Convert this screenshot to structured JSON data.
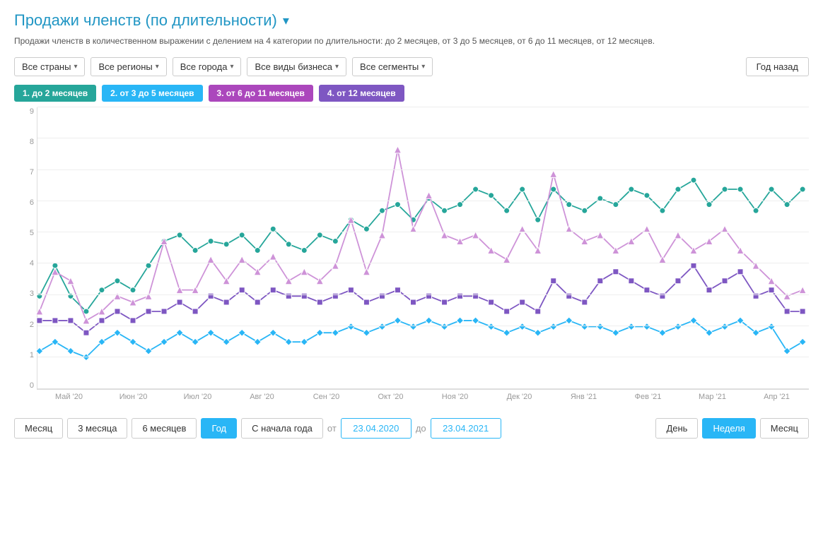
{
  "title": "Продажи членств (по длительности)",
  "subtitle": "Продажи членств в количественном выражении с делением на 4 категории по длительности: до 2 месяцев, от 3 до 5 месяцев, от 6 до 11 месяцев, от 12 месяцев.",
  "filters": [
    {
      "label": "Все страны",
      "id": "countries"
    },
    {
      "label": "Все регионы",
      "id": "regions"
    },
    {
      "label": "Все города",
      "id": "cities"
    },
    {
      "label": "Все виды бизнеса",
      "id": "business"
    },
    {
      "label": "Все сегменты",
      "id": "segments"
    }
  ],
  "year_btn_label": "Год назад",
  "legend": [
    {
      "label": "1. до 2 месяцев",
      "class": "chip-green"
    },
    {
      "label": "2. от 3 до 5 месяцев",
      "class": "chip-blue"
    },
    {
      "label": "3. от 6 до 11 месяцев",
      "class": "chip-pink"
    },
    {
      "label": "4. от 12 месяцев",
      "class": "chip-purple"
    }
  ],
  "y_labels": [
    "0",
    "1",
    "2",
    "3",
    "4",
    "5",
    "6",
    "7",
    "8",
    "9"
  ],
  "x_labels": [
    "Май '20",
    "Июн '20",
    "Июл '20",
    "Авг '20",
    "Сен '20",
    "Окт '20",
    "Ноя '20",
    "Дек '20",
    "Янв '21",
    "Фев '21",
    "Мар '21",
    "Апр '21"
  ],
  "bottom_controls": {
    "period_buttons": [
      "Месяц",
      "3 месяца",
      "6 месяцев",
      "Год",
      "С начала года"
    ],
    "active_period": "Год",
    "from_label": "от",
    "to_label": "до",
    "from_date": "23.04.2020",
    "to_date": "23.04.2021",
    "view_buttons": [
      "День",
      "Неделя",
      "Месяц"
    ],
    "active_view": "Неделя"
  },
  "chart": {
    "green": [
      3.0,
      4.0,
      3.0,
      2.5,
      3.2,
      3.5,
      3.2,
      4.0,
      4.8,
      5.0,
      4.5,
      4.8,
      4.7,
      5.0,
      4.5,
      5.2,
      4.7,
      4.5,
      5.0,
      4.8,
      5.5,
      5.2,
      5.8,
      6.0,
      5.5,
      6.2,
      5.8,
      6.0,
      6.5,
      6.3,
      5.8,
      6.5,
      5.5,
      6.5,
      6.0,
      5.8,
      6.2,
      6.0,
      6.5,
      6.3,
      5.8,
      6.5,
      6.8,
      6.0,
      6.5,
      6.5,
      5.8,
      6.5,
      6.0,
      6.5
    ],
    "blue": [
      1.2,
      1.5,
      1.2,
      1.0,
      1.5,
      1.8,
      1.5,
      1.2,
      1.5,
      1.8,
      1.5,
      1.8,
      1.5,
      1.8,
      1.5,
      1.8,
      1.5,
      1.5,
      1.8,
      1.8,
      2.0,
      1.8,
      2.0,
      2.2,
      2.0,
      2.2,
      2.0,
      2.2,
      2.2,
      2.0,
      1.8,
      2.0,
      1.8,
      2.0,
      2.2,
      2.0,
      2.0,
      1.8,
      2.0,
      2.0,
      1.8,
      2.0,
      2.2,
      1.8,
      2.0,
      2.2,
      1.8,
      2.0,
      1.2,
      1.5
    ],
    "pink": [
      2.5,
      3.8,
      3.5,
      2.2,
      2.5,
      3.0,
      2.8,
      3.0,
      4.8,
      3.2,
      3.2,
      4.2,
      3.5,
      4.2,
      3.8,
      4.3,
      3.5,
      3.8,
      3.5,
      4.0,
      5.5,
      3.8,
      5.0,
      7.8,
      5.2,
      6.3,
      5.0,
      4.8,
      5.0,
      4.5,
      4.2,
      5.2,
      4.5,
      7.0,
      5.2,
      4.8,
      5.0,
      4.5,
      4.8,
      5.2,
      4.2,
      5.0,
      4.5,
      4.8,
      5.2,
      4.5,
      4.0,
      3.5,
      3.0,
      3.2
    ],
    "purple": [
      2.2,
      2.2,
      2.2,
      1.8,
      2.2,
      2.5,
      2.2,
      2.5,
      2.5,
      2.8,
      2.5,
      3.0,
      2.8,
      3.2,
      2.8,
      3.2,
      3.0,
      3.0,
      2.8,
      3.0,
      3.2,
      2.8,
      3.0,
      3.2,
      2.8,
      3.0,
      2.8,
      3.0,
      3.0,
      2.8,
      2.5,
      2.8,
      2.5,
      3.5,
      3.0,
      2.8,
      3.5,
      3.8,
      3.5,
      3.2,
      3.0,
      3.5,
      4.0,
      3.2,
      3.5,
      3.8,
      3.0,
      3.2,
      2.5,
      2.5
    ]
  }
}
